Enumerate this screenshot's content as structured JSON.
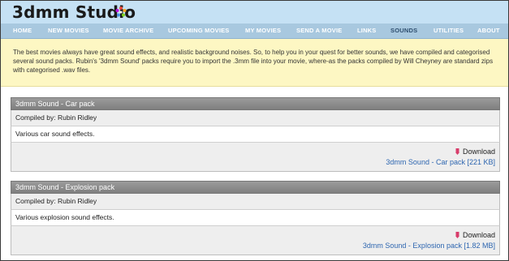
{
  "header": {
    "logo_text": "3dmm Studio",
    "logo_icon": "flower-icon"
  },
  "nav": {
    "items": [
      {
        "label": "HOME"
      },
      {
        "label": "NEW MOVIES"
      },
      {
        "label": "MOVIE ARCHIVE"
      },
      {
        "label": "UPCOMING MOVIES"
      },
      {
        "label": "MY MOVIES"
      },
      {
        "label": "SEND A MOVIE"
      },
      {
        "label": "LINKS"
      },
      {
        "label": "SOUNDS",
        "active": true
      },
      {
        "label": "UTILITIES"
      },
      {
        "label": "ABOUT"
      }
    ]
  },
  "intro": {
    "text": "The best movies always have great sound effects, and realistic background noises. So, to help you in your quest for better sounds, we have compiled and categorised several sound packs. Rubin's '3dmm Sound' packs require you to import the .3mm file into your movie, where-as the packs compiled by Will Cheyney are standard zips with categorised .wav files."
  },
  "packs": [
    {
      "title": "3dmm Sound - Car pack",
      "compiled_by": "Compiled by: Rubin Ridley",
      "description": "Various car sound effects.",
      "download_label": "Download",
      "link_text": "3dmm Sound - Car pack [221 KB]"
    },
    {
      "title": "3dmm Sound - Explosion pack",
      "compiled_by": "Compiled by: Rubin Ridley",
      "description": "Various explosion sound effects.",
      "download_label": "Download",
      "link_text": "3dmm Sound - Explosion pack [1.82 MB]"
    }
  ],
  "colors": {
    "header_bg": "#c5e1f4",
    "nav_bg": "#a8c8df",
    "intro_bg": "#fdf7c3",
    "link": "#2e66b0",
    "download_icon": "#d83c6a"
  }
}
